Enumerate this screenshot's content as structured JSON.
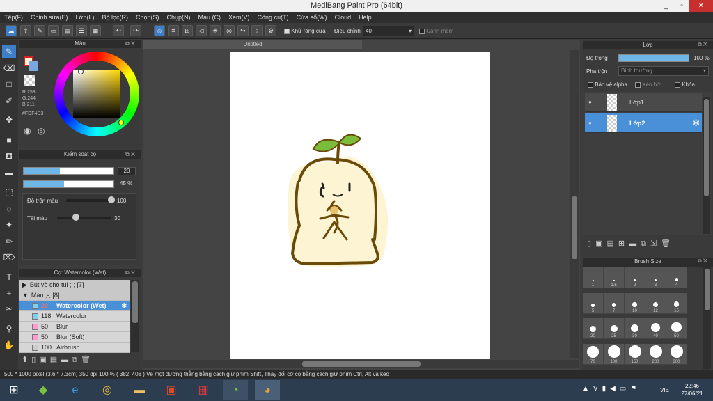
{
  "window": {
    "title": "MediBang Paint Pro (64bit)",
    "min": "_",
    "max": "▫",
    "close": "✕"
  },
  "menu": [
    "Tệp(F)",
    "Chỉnh sửa(E)",
    "Lớp(L)",
    "Bộ lọc(R)",
    "Chọn(S)",
    "Chụp(N)",
    "Màu (C)",
    "Xem(V)",
    "Công cụ(T)",
    "Cửa sổ(W)",
    "Cloud",
    "Help"
  ],
  "toolbar": {
    "antialias_label": "Khử răng cưa",
    "adjust_label": "Điều chỉnh",
    "adjust_value": "40",
    "edge_label": "Canh mềm"
  },
  "color_panel": {
    "title": "Màu",
    "r": "R:253",
    "g": "G:244",
    "b": "B:211",
    "hex": "#FDF4D3"
  },
  "brush_control": {
    "title": "Kiểm soát cọ",
    "size": "20",
    "opacity": "45 %",
    "blend_label": "Độ trộn màu",
    "blend_value": "100",
    "load_label": "Tải màu",
    "load_value": "30",
    "size_fraction": 0.4,
    "opacity_fraction": 0.45,
    "blend_fraction": 1.0,
    "load_fraction": 0.3
  },
  "brush_list": {
    "title": "Cọ: Watercolor (Wet)",
    "groups": [
      {
        "label": "Bút vẽ cho tui ;-; [7]"
      },
      {
        "label": "Màu ;-; [8]"
      }
    ],
    "items": [
      {
        "size": "20",
        "name": "Watercolor (Wet)",
        "color": "#7fd0f0"
      },
      {
        "size": "118",
        "name": "Watercolor",
        "color": "#7fd0f0"
      },
      {
        "size": "50",
        "name": "Blur",
        "color": "#ff9ad5"
      },
      {
        "size": "50",
        "name": "Blur (Soft)",
        "color": "#ff9ad5"
      },
      {
        "size": "100",
        "name": "Airbrush",
        "color": "#cccccc"
      }
    ]
  },
  "canvas": {
    "tab": "Untitled"
  },
  "layer_panel": {
    "title": "Lớp",
    "opacity_label": "Độ trong",
    "opacity_value": "100 %",
    "blend_label": "Pha trộn",
    "blend_value": "Bình thường",
    "protect_alpha": "Bảo vệ alpha",
    "clip": "Xén bớt",
    "lock": "Khóa",
    "layers": [
      {
        "name": "Lớp1"
      },
      {
        "name": "Lớp2"
      }
    ]
  },
  "brush_size": {
    "title": "Brush Size",
    "sizes": [
      "1",
      "1.5",
      "2",
      "3",
      "4",
      "5",
      "7",
      "10",
      "12",
      "15",
      "20",
      "25",
      "30",
      "40",
      "50",
      "70",
      "100",
      "150",
      "200",
      "300"
    ]
  },
  "status": "500 * 1000 pixel   (3.6 * 7.3cm)   350 dpi   100 %   ( 382, 408 )   Vẽ một đường thẳng bằng cách giữ phím Shift, Thay đổi cỡ cọ bằng cách giữ phím Ctrl, Alt và kéo",
  "taskbar": {
    "lang": "VIE",
    "time": "22:46",
    "date": "27/06/21"
  }
}
